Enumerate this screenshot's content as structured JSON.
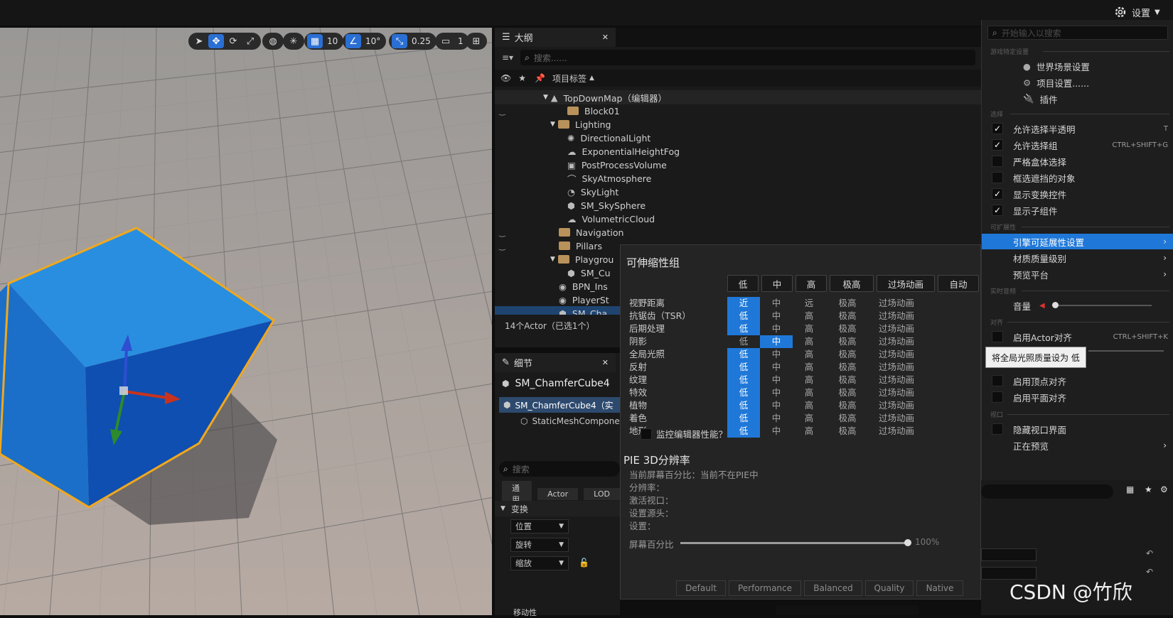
{
  "topbar": {
    "settings_label": "设置"
  },
  "viewport_toolbar": {
    "grid_value": "10",
    "angle_value": "10°",
    "scale_value": "0.25",
    "camera_value": "1"
  },
  "outliner": {
    "tab_label": "大纲",
    "search_placeholder": "搜索......",
    "column_label": "项目标签",
    "items": [
      {
        "label": "TopDownMap（编辑器）",
        "kind": "map"
      },
      {
        "label": "Block01",
        "kind": "folder"
      },
      {
        "label": "Lighting",
        "kind": "folder-open"
      },
      {
        "label": "DirectionalLight",
        "kind": "light"
      },
      {
        "label": "ExponentialHeightFog",
        "kind": "fog"
      },
      {
        "label": "PostProcessVolume",
        "kind": "volume"
      },
      {
        "label": "SkyAtmosphere",
        "kind": "sky"
      },
      {
        "label": "SkyLight",
        "kind": "skylight"
      },
      {
        "label": "SM_SkySphere",
        "kind": "mesh"
      },
      {
        "label": "VolumetricCloud",
        "kind": "cloud"
      },
      {
        "label": "Navigation",
        "kind": "folder"
      },
      {
        "label": "Pillars",
        "kind": "folder"
      },
      {
        "label": "Playgrou",
        "kind": "folder-open"
      },
      {
        "label": "SM_Cu",
        "kind": "mesh"
      },
      {
        "label": "BPN_Ins",
        "kind": "actor"
      },
      {
        "label": "PlayerSt",
        "kind": "actor"
      },
      {
        "label": "SM_Cha",
        "kind": "mesh"
      }
    ],
    "actor_count": "14个Actor（已选1个）"
  },
  "details": {
    "tab_label": "细节",
    "object_name": "SM_ChamferCube4",
    "component_root": "SM_ChamferCube4（实",
    "component_child": "StaticMeshCompone",
    "search_placeholder": "搜索",
    "filters": [
      "通用",
      "Actor",
      "LOD"
    ],
    "section_transform": "变换",
    "location_label": "位置",
    "rotation_label": "旋转",
    "scale_label": "缩放",
    "mobility_label": "移动性"
  },
  "scalability": {
    "title": "可伸缩性组",
    "header_buttons": [
      "低",
      "中",
      "高",
      "极高",
      "过场动画",
      "自动"
    ],
    "rows": [
      {
        "label": "视野距离",
        "values": [
          "近",
          "中",
          "远",
          "极高",
          "过场动画"
        ],
        "selected": 0
      },
      {
        "label": "抗锯齿（TSR）",
        "values": [
          "低",
          "中",
          "高",
          "极高",
          "过场动画"
        ],
        "selected": 0
      },
      {
        "label": "后期处理",
        "values": [
          "低",
          "中",
          "高",
          "极高",
          "过场动画"
        ],
        "selected": 0
      },
      {
        "label": "阴影",
        "values": [
          "低",
          "中",
          "高",
          "极高",
          "过场动画"
        ],
        "selected": 1
      },
      {
        "label": "全局光照",
        "values": [
          "低",
          "中",
          "高",
          "极高",
          "过场动画"
        ],
        "selected": 0
      },
      {
        "label": "反射",
        "values": [
          "低",
          "中",
          "高",
          "极高",
          "过场动画"
        ],
        "selected": 0
      },
      {
        "label": "纹理",
        "values": [
          "低",
          "中",
          "高",
          "极高",
          "过场动画"
        ],
        "selected": 0
      },
      {
        "label": "特效",
        "values": [
          "低",
          "中",
          "高",
          "极高",
          "过场动画"
        ],
        "selected": 0
      },
      {
        "label": "植物",
        "values": [
          "低",
          "中",
          "高",
          "极高",
          "过场动画"
        ],
        "selected": 0
      },
      {
        "label": "着色",
        "values": [
          "低",
          "中",
          "高",
          "极高",
          "过场动画"
        ],
        "selected": 0
      },
      {
        "label": "地形",
        "values": [
          "低",
          "中",
          "高",
          "极高",
          "过场动画"
        ],
        "selected": 0
      }
    ],
    "monitor_label": "监控编辑器性能？",
    "pie_title": "PIE 3D分辨率",
    "pie_lines": [
      "当前屏幕百分比：当前不在PIE中",
      "分辨率：",
      "激活视口：",
      "设置源头：",
      "设置："
    ],
    "screen_pct_label": "屏幕百分比",
    "screen_pct_value": "100%",
    "screen_pct_fraction": 1.0,
    "presets": [
      "Default",
      "Performance",
      "Balanced",
      "Quality",
      "Native"
    ]
  },
  "settings_menu": {
    "search_placeholder": "开始输入以搜索",
    "sec_game": "游戏特定设置",
    "world_settings": "世界场景设置",
    "project_settings": "项目设置......",
    "plugins": "插件",
    "sec_select": "选择",
    "checks": [
      {
        "label": "允许选择半透明",
        "checked": true,
        "shortcut": "T"
      },
      {
        "label": "允许选择组",
        "checked": true,
        "shortcut": "CTRL+SHIFT+G"
      },
      {
        "label": "严格盒体选择",
        "checked": false,
        "shortcut": ""
      },
      {
        "label": "框选遮挡的对象",
        "checked": false,
        "shortcut": ""
      },
      {
        "label": "显示变换控件",
        "checked": true,
        "shortcut": ""
      },
      {
        "label": "显示子组件",
        "checked": true,
        "shortcut": ""
      }
    ],
    "sec_scalable": "可扩展性",
    "engine_scalability": "引擎可延展性设置",
    "material_quality": "材质质量级别",
    "preview_platform": "预览平台",
    "sec_realtime": "实时音频",
    "volume_label": "音量",
    "sec_snap": "对齐",
    "actor_snap": "启用Actor对齐",
    "actor_snap_shortcut": "CTRL+SHIFT+K",
    "tooltip": "将全局光照质量设为 低",
    "vertex_snap": "启用顶点对齐",
    "plane_snap": "启用平面对齐",
    "sec_viewport": "视口",
    "hide_ui": "隐藏视口界面",
    "previewing": "正在预览"
  },
  "watermark": "CSDN @竹欣"
}
